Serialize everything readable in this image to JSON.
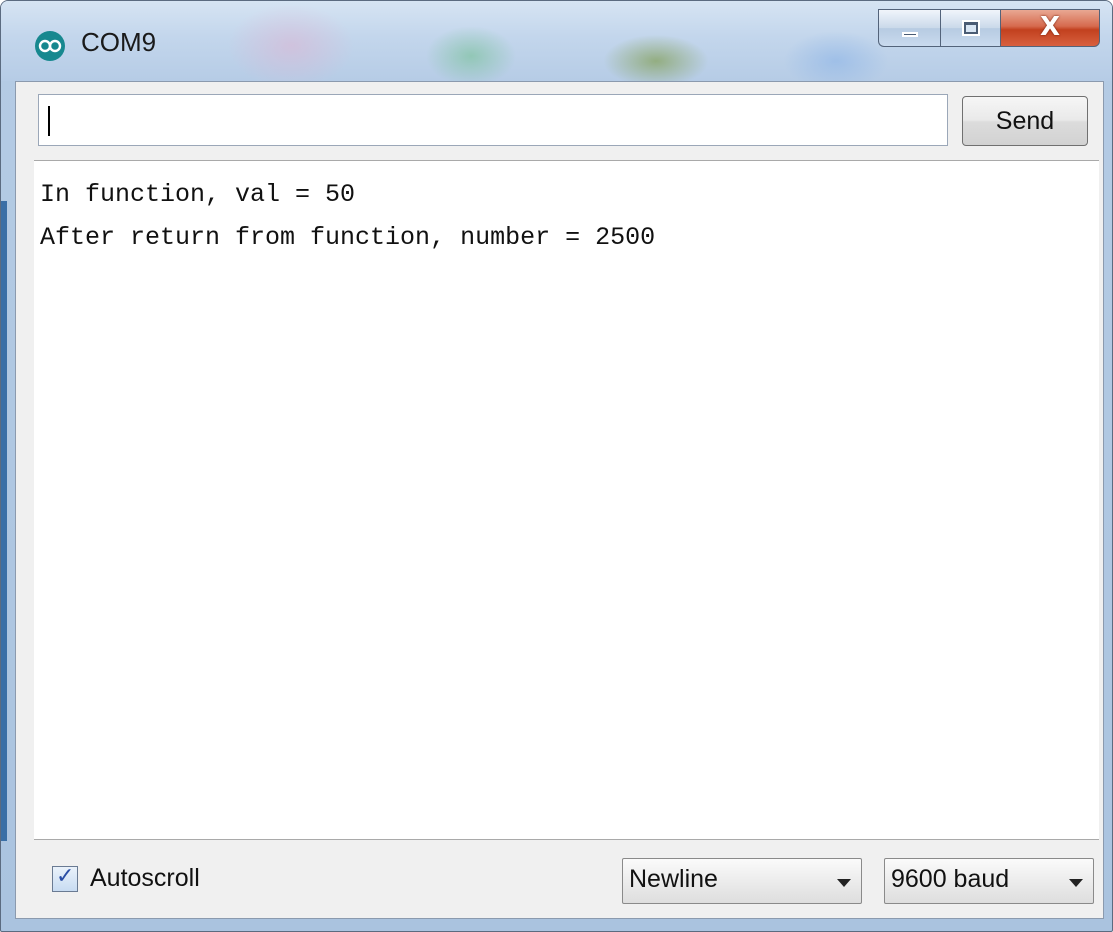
{
  "window": {
    "title": "COM9",
    "icon": "arduino-infinity-icon",
    "close_glyph": "X"
  },
  "input": {
    "value": "",
    "send_label": "Send"
  },
  "output": {
    "lines": [
      "In function, val = 50",
      "After return from function, number = 2500"
    ]
  },
  "footer": {
    "autoscroll_label": "Autoscroll",
    "autoscroll_checked": true,
    "line_ending": "Newline",
    "baud_rate": "9600 baud"
  },
  "colors": {
    "app_icon": "#17888f",
    "close_button": "#c2411f"
  }
}
